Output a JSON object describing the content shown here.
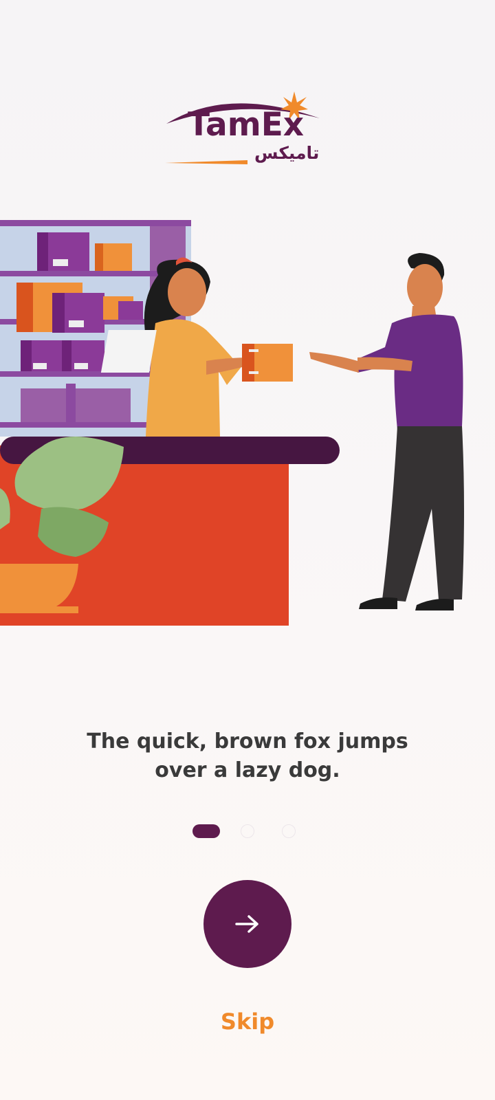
{
  "brand": {
    "name": "TamEx",
    "name_arabic": "تاميكس",
    "primary_color": "#5e1b4e",
    "accent_color": "#f08a2b"
  },
  "onboarding": {
    "headline_line1": "The quick, brown fox jumps",
    "headline_line2": "over a lazy dog.",
    "page_indicator": {
      "total": 3,
      "current": 1
    },
    "next_icon": "arrow-right-icon",
    "skip_label": "Skip"
  }
}
